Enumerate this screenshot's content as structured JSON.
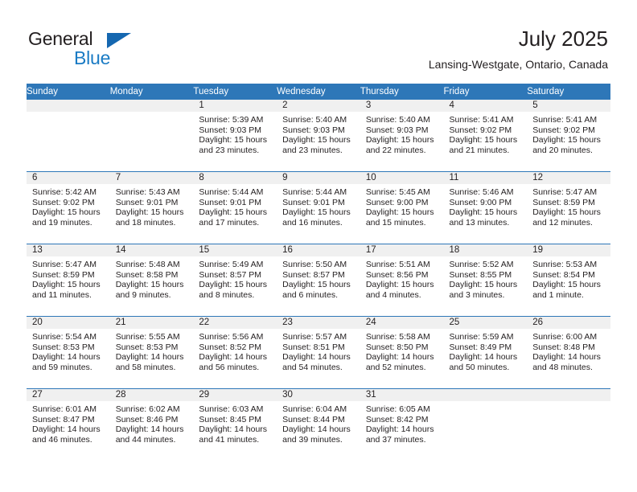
{
  "brand": {
    "line1": "General",
    "line2": "Blue",
    "triangle_color": "#1567b0",
    "blue_text_color": "#1a7bc4"
  },
  "header": {
    "title": "July 2025",
    "subtitle": "Lansing-Westgate, Ontario, Canada"
  },
  "theme": {
    "header_blue": "#2e77b8",
    "daynum_band": "#f0f0f0",
    "text": "#231f20"
  },
  "weekdays": [
    "Sunday",
    "Monday",
    "Tuesday",
    "Wednesday",
    "Thursday",
    "Friday",
    "Saturday"
  ],
  "weeks": [
    [
      {
        "day": "",
        "lines": []
      },
      {
        "day": "",
        "lines": []
      },
      {
        "day": "1",
        "lines": [
          "Sunrise: 5:39 AM",
          "Sunset: 9:03 PM",
          "Daylight: 15 hours",
          "and 23 minutes."
        ]
      },
      {
        "day": "2",
        "lines": [
          "Sunrise: 5:40 AM",
          "Sunset: 9:03 PM",
          "Daylight: 15 hours",
          "and 23 minutes."
        ]
      },
      {
        "day": "3",
        "lines": [
          "Sunrise: 5:40 AM",
          "Sunset: 9:03 PM",
          "Daylight: 15 hours",
          "and 22 minutes."
        ]
      },
      {
        "day": "4",
        "lines": [
          "Sunrise: 5:41 AM",
          "Sunset: 9:02 PM",
          "Daylight: 15 hours",
          "and 21 minutes."
        ]
      },
      {
        "day": "5",
        "lines": [
          "Sunrise: 5:41 AM",
          "Sunset: 9:02 PM",
          "Daylight: 15 hours",
          "and 20 minutes."
        ]
      }
    ],
    [
      {
        "day": "6",
        "lines": [
          "Sunrise: 5:42 AM",
          "Sunset: 9:02 PM",
          "Daylight: 15 hours",
          "and 19 minutes."
        ]
      },
      {
        "day": "7",
        "lines": [
          "Sunrise: 5:43 AM",
          "Sunset: 9:01 PM",
          "Daylight: 15 hours",
          "and 18 minutes."
        ]
      },
      {
        "day": "8",
        "lines": [
          "Sunrise: 5:44 AM",
          "Sunset: 9:01 PM",
          "Daylight: 15 hours",
          "and 17 minutes."
        ]
      },
      {
        "day": "9",
        "lines": [
          "Sunrise: 5:44 AM",
          "Sunset: 9:01 PM",
          "Daylight: 15 hours",
          "and 16 minutes."
        ]
      },
      {
        "day": "10",
        "lines": [
          "Sunrise: 5:45 AM",
          "Sunset: 9:00 PM",
          "Daylight: 15 hours",
          "and 15 minutes."
        ]
      },
      {
        "day": "11",
        "lines": [
          "Sunrise: 5:46 AM",
          "Sunset: 9:00 PM",
          "Daylight: 15 hours",
          "and 13 minutes."
        ]
      },
      {
        "day": "12",
        "lines": [
          "Sunrise: 5:47 AM",
          "Sunset: 8:59 PM",
          "Daylight: 15 hours",
          "and 12 minutes."
        ]
      }
    ],
    [
      {
        "day": "13",
        "lines": [
          "Sunrise: 5:47 AM",
          "Sunset: 8:59 PM",
          "Daylight: 15 hours",
          "and 11 minutes."
        ]
      },
      {
        "day": "14",
        "lines": [
          "Sunrise: 5:48 AM",
          "Sunset: 8:58 PM",
          "Daylight: 15 hours",
          "and 9 minutes."
        ]
      },
      {
        "day": "15",
        "lines": [
          "Sunrise: 5:49 AM",
          "Sunset: 8:57 PM",
          "Daylight: 15 hours",
          "and 8 minutes."
        ]
      },
      {
        "day": "16",
        "lines": [
          "Sunrise: 5:50 AM",
          "Sunset: 8:57 PM",
          "Daylight: 15 hours",
          "and 6 minutes."
        ]
      },
      {
        "day": "17",
        "lines": [
          "Sunrise: 5:51 AM",
          "Sunset: 8:56 PM",
          "Daylight: 15 hours",
          "and 4 minutes."
        ]
      },
      {
        "day": "18",
        "lines": [
          "Sunrise: 5:52 AM",
          "Sunset: 8:55 PM",
          "Daylight: 15 hours",
          "and 3 minutes."
        ]
      },
      {
        "day": "19",
        "lines": [
          "Sunrise: 5:53 AM",
          "Sunset: 8:54 PM",
          "Daylight: 15 hours",
          "and 1 minute."
        ]
      }
    ],
    [
      {
        "day": "20",
        "lines": [
          "Sunrise: 5:54 AM",
          "Sunset: 8:53 PM",
          "Daylight: 14 hours",
          "and 59 minutes."
        ]
      },
      {
        "day": "21",
        "lines": [
          "Sunrise: 5:55 AM",
          "Sunset: 8:53 PM",
          "Daylight: 14 hours",
          "and 58 minutes."
        ]
      },
      {
        "day": "22",
        "lines": [
          "Sunrise: 5:56 AM",
          "Sunset: 8:52 PM",
          "Daylight: 14 hours",
          "and 56 minutes."
        ]
      },
      {
        "day": "23",
        "lines": [
          "Sunrise: 5:57 AM",
          "Sunset: 8:51 PM",
          "Daylight: 14 hours",
          "and 54 minutes."
        ]
      },
      {
        "day": "24",
        "lines": [
          "Sunrise: 5:58 AM",
          "Sunset: 8:50 PM",
          "Daylight: 14 hours",
          "and 52 minutes."
        ]
      },
      {
        "day": "25",
        "lines": [
          "Sunrise: 5:59 AM",
          "Sunset: 8:49 PM",
          "Daylight: 14 hours",
          "and 50 minutes."
        ]
      },
      {
        "day": "26",
        "lines": [
          "Sunrise: 6:00 AM",
          "Sunset: 8:48 PM",
          "Daylight: 14 hours",
          "and 48 minutes."
        ]
      }
    ],
    [
      {
        "day": "27",
        "lines": [
          "Sunrise: 6:01 AM",
          "Sunset: 8:47 PM",
          "Daylight: 14 hours",
          "and 46 minutes."
        ]
      },
      {
        "day": "28",
        "lines": [
          "Sunrise: 6:02 AM",
          "Sunset: 8:46 PM",
          "Daylight: 14 hours",
          "and 44 minutes."
        ]
      },
      {
        "day": "29",
        "lines": [
          "Sunrise: 6:03 AM",
          "Sunset: 8:45 PM",
          "Daylight: 14 hours",
          "and 41 minutes."
        ]
      },
      {
        "day": "30",
        "lines": [
          "Sunrise: 6:04 AM",
          "Sunset: 8:44 PM",
          "Daylight: 14 hours",
          "and 39 minutes."
        ]
      },
      {
        "day": "31",
        "lines": [
          "Sunrise: 6:05 AM",
          "Sunset: 8:42 PM",
          "Daylight: 14 hours",
          "and 37 minutes."
        ]
      },
      {
        "day": "",
        "lines": []
      },
      {
        "day": "",
        "lines": []
      }
    ]
  ]
}
